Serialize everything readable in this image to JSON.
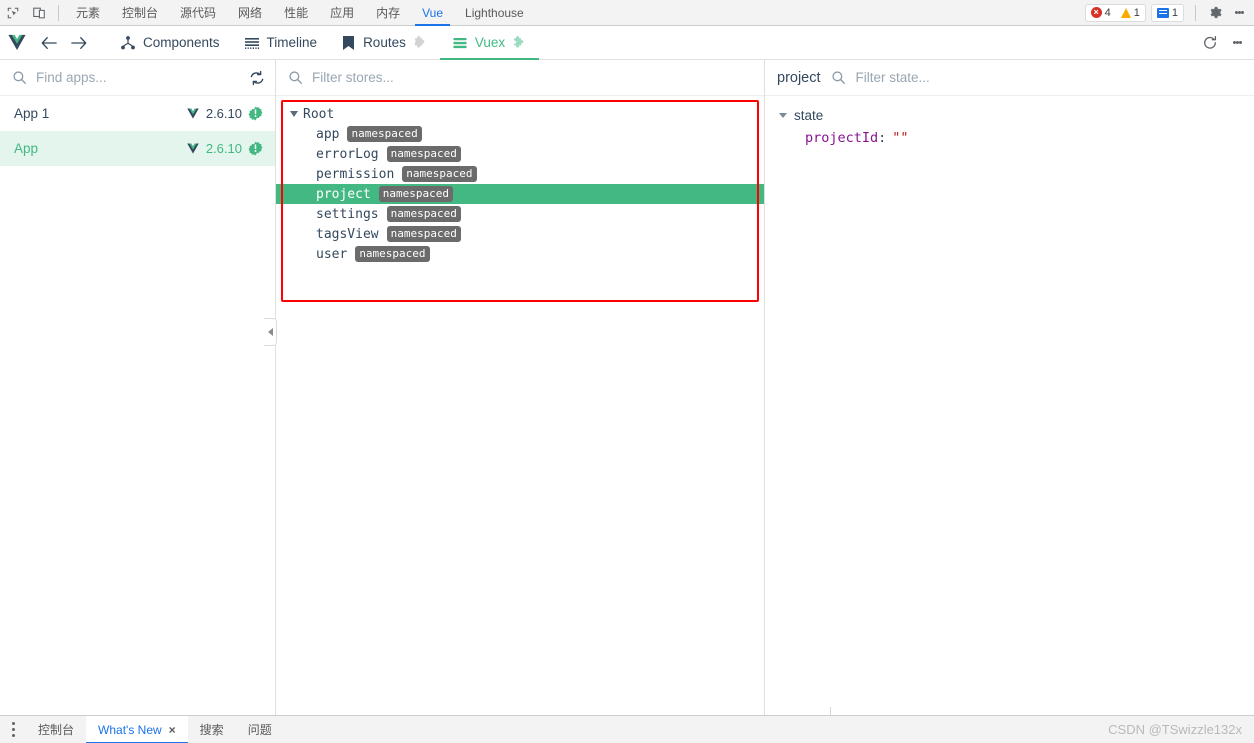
{
  "devtools": {
    "icons": {
      "inspect": "inspect-element-icon",
      "device": "device-toolbar-icon"
    },
    "tabs": [
      {
        "label": "元素",
        "active": false
      },
      {
        "label": "控制台",
        "active": false
      },
      {
        "label": "源代码",
        "active": false
      },
      {
        "label": "网络",
        "active": false
      },
      {
        "label": "性能",
        "active": false
      },
      {
        "label": "应用",
        "active": false
      },
      {
        "label": "内存",
        "active": false
      },
      {
        "label": "Vue",
        "active": true
      },
      {
        "label": "Lighthouse",
        "active": false
      }
    ],
    "status": {
      "errors": "4",
      "warnings": "1",
      "messages": "1"
    },
    "colors": {
      "error": "#d93025",
      "warning": "#f9ab00",
      "message": "#1a73e8",
      "active_tab": "#1a73e8"
    }
  },
  "vue_toolbar": {
    "logo": "vue-logo",
    "back": "back-arrow-icon",
    "forward": "forward-arrow-icon",
    "tabs": [
      {
        "label": "Components",
        "icon": "components-icon",
        "active": false,
        "plugin": false
      },
      {
        "label": "Timeline",
        "icon": "timeline-icon",
        "active": false,
        "plugin": false
      },
      {
        "label": "Routes",
        "icon": "routes-icon",
        "active": false,
        "plugin": true
      },
      {
        "label": "Vuex",
        "icon": "vuex-icon",
        "active": true,
        "plugin": true
      }
    ],
    "reload": "reload-icon",
    "more": "more-options-icon",
    "accent": "#42b883"
  },
  "apps_pane": {
    "search_placeholder": "Find apps...",
    "refresh_icon": "refresh-icon",
    "apps": [
      {
        "name": "App 1",
        "version": "2.6.10",
        "selected": false
      },
      {
        "name": "App",
        "version": "2.6.10",
        "selected": true
      }
    ]
  },
  "stores_pane": {
    "filter_placeholder": "Filter stores...",
    "tree": [
      {
        "label": "Root",
        "depth": 0,
        "expanded": true,
        "badge": null,
        "selected": false
      },
      {
        "label": "app",
        "depth": 1,
        "expanded": false,
        "badge": "namespaced",
        "selected": false
      },
      {
        "label": "errorLog",
        "depth": 1,
        "expanded": false,
        "badge": "namespaced",
        "selected": false
      },
      {
        "label": "permission",
        "depth": 1,
        "expanded": false,
        "badge": "namespaced",
        "selected": false
      },
      {
        "label": "project",
        "depth": 1,
        "expanded": false,
        "badge": "namespaced",
        "selected": true
      },
      {
        "label": "settings",
        "depth": 1,
        "expanded": false,
        "badge": "namespaced",
        "selected": false
      },
      {
        "label": "tagsView",
        "depth": 1,
        "expanded": false,
        "badge": "namespaced",
        "selected": false
      },
      {
        "label": "user",
        "depth": 1,
        "expanded": false,
        "badge": "namespaced",
        "selected": false
      }
    ],
    "highlight_color": "#44b883",
    "annotation_color": "#ff0000"
  },
  "state_pane": {
    "title": "project",
    "filter_placeholder": "Filter state...",
    "section": "state",
    "entries": [
      {
        "key": "projectId",
        "colon": ":",
        "value": "\"\""
      }
    ]
  },
  "drawer": {
    "tabs": [
      {
        "label": "控制台",
        "active": false,
        "closable": false
      },
      {
        "label": "What's New",
        "active": true,
        "closable": true,
        "close": "×"
      },
      {
        "label": "搜索",
        "active": false,
        "closable": false
      },
      {
        "label": "问题",
        "active": false,
        "closable": false
      }
    ],
    "watermark": "CSDN @TSwizzle132x"
  }
}
